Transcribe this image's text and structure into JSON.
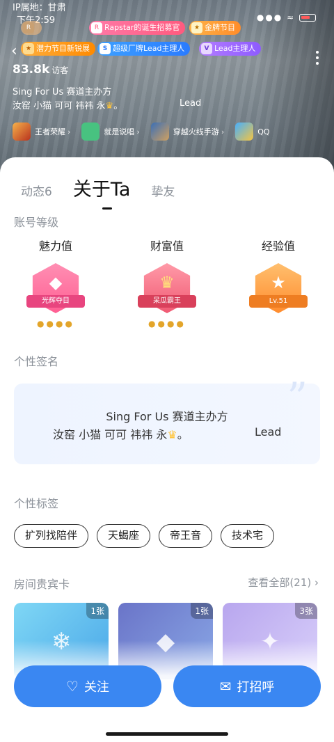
{
  "status_bar": {
    "ip": "IP属地：甘肃",
    "time": "下午2:59",
    "signal": "▲▍▍▍"
  },
  "header": {
    "badges": [
      {
        "label": "",
        "icon": "R"
      },
      {
        "label": "Rapstar的诞生招募官",
        "icon": "R"
      },
      {
        "label": "金牌节目",
        "icon": "★"
      },
      {
        "label": "潜力节目新锐展",
        "icon": "★"
      },
      {
        "label": "超级厂牌Lead主理人",
        "icon": "S"
      },
      {
        "label": "Lead主理人",
        "icon": "V"
      }
    ],
    "visitors_count": "83.8k",
    "visitors_label": "访客",
    "bio_line1": "Sing For Us 赛道主办方",
    "bio_line2": "汝窑 小猫 可可 祎祎 永",
    "bio_crown": "♛",
    "bio_tail": "。",
    "bio_lead": "Lead",
    "games": [
      {
        "name": "王者荣耀"
      },
      {
        "name": "就是说唱"
      },
      {
        "name": "穿越火线手游"
      },
      {
        "name": "QQ"
      }
    ]
  },
  "tabs": [
    {
      "label": "动态6"
    },
    {
      "label": "关于Ta"
    },
    {
      "label": "挚友"
    }
  ],
  "account_level": {
    "title": "账号等级",
    "items": [
      {
        "title": "魅力值",
        "ribbon": "光辉夺目",
        "glyph": "◆"
      },
      {
        "title": "财富值",
        "ribbon": "呆瓜霸王",
        "glyph": "♛"
      },
      {
        "title": "经验值",
        "ribbon": "Lv.51",
        "glyph": "★"
      }
    ]
  },
  "signature": {
    "title": "个性签名",
    "line1": "Sing For Us 赛道主办方",
    "line2": "汝窑 小猫 可可 祎祎 永",
    "crown": "♛",
    "tail": "。",
    "lead": "Lead"
  },
  "personal_tags": {
    "title": "个性标签",
    "items": [
      "扩列找陪伴",
      "天蝎座",
      "帝王音",
      "技术宅"
    ]
  },
  "vip_cards": {
    "title": "房间贵宾卡",
    "more": "查看全部(21)",
    "items": [
      {
        "count": "1张"
      },
      {
        "count": "1张"
      },
      {
        "count": "3张"
      }
    ]
  },
  "actions": {
    "follow": "关注",
    "greet": "打招呼"
  }
}
